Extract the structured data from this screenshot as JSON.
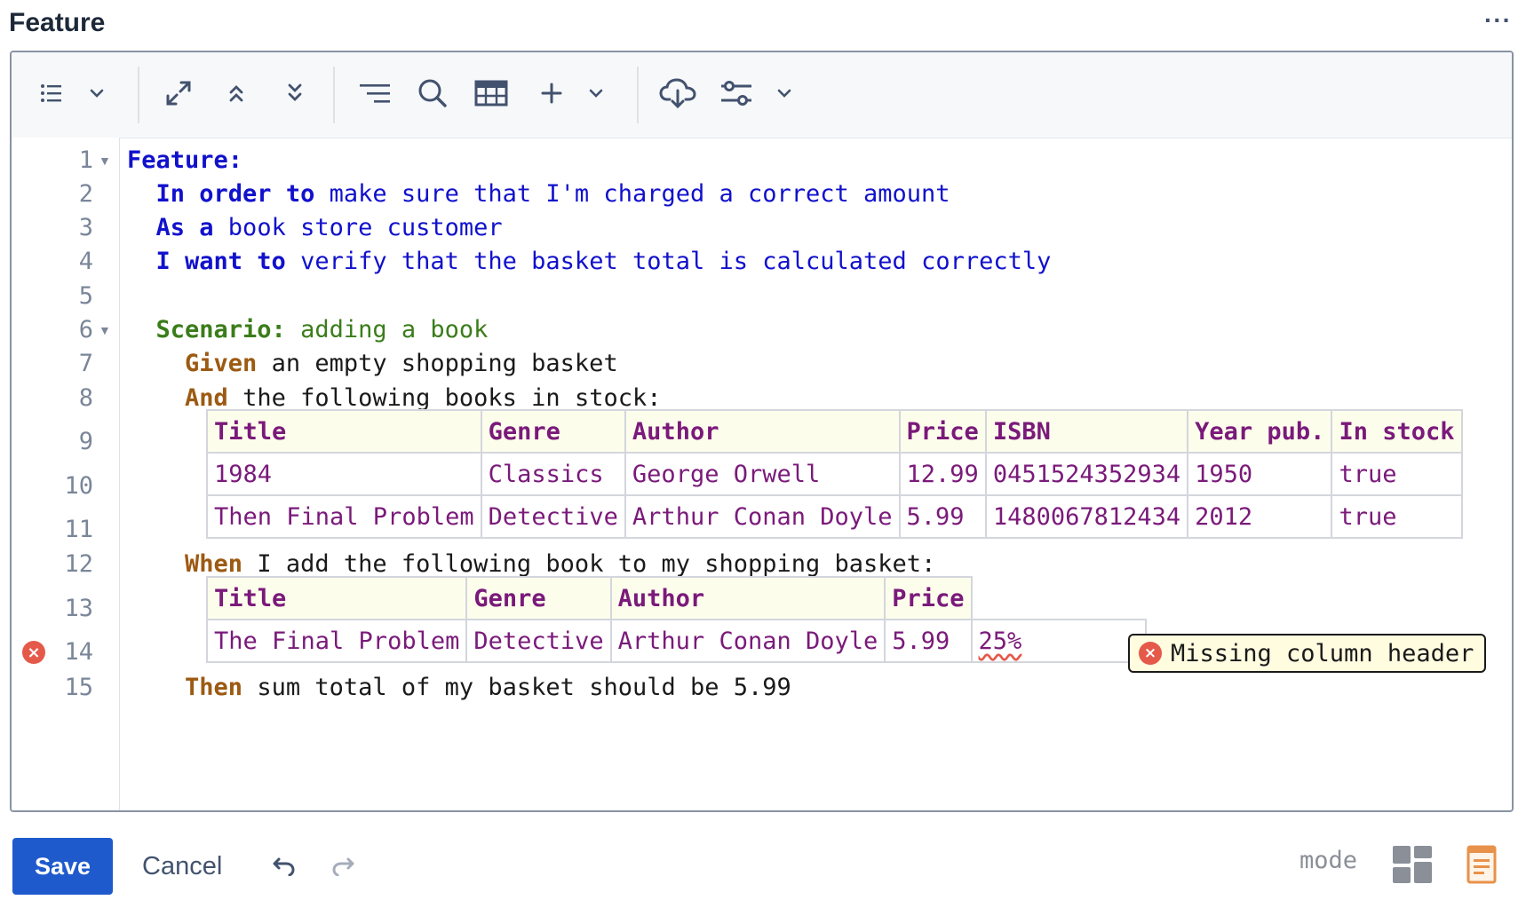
{
  "header": {
    "title": "Feature",
    "more_label": "···"
  },
  "toolbar": {
    "icons": [
      "list-icon",
      "chevron-down-icon",
      "expand-icon",
      "collapse-up-icon",
      "collapse-down-icon",
      "format-icon",
      "search-icon",
      "table-icon",
      "plus-icon",
      "chevron-down-icon",
      "cloud-download-icon",
      "settings-sliders-icon",
      "chevron-down-icon"
    ]
  },
  "editor": {
    "line_numbers": [
      "1",
      "2",
      "3",
      "4",
      "5",
      "6",
      "7",
      "8",
      "9",
      "10",
      "11",
      "12",
      "13",
      "14",
      "15"
    ],
    "line1": {
      "kw": "Feature:"
    },
    "line2": {
      "kw": "In order to",
      "text": " make sure that I'm charged a correct amount"
    },
    "line3": {
      "kw": "As a",
      "text": " book store customer"
    },
    "line4": {
      "kw": "I want to",
      "text": " verify that the basket total is calculated correctly"
    },
    "line6": {
      "kw": "Scenario:",
      "text": " adding a book"
    },
    "line7": {
      "kw": "Given",
      "text": " an empty shopping basket"
    },
    "line8": {
      "kw": "And",
      "text": " the following books in stock:"
    },
    "table1": {
      "headers": [
        "Title",
        "Genre",
        "Author",
        "Price",
        "ISBN",
        "Year pub.",
        "In stock"
      ],
      "rows": [
        [
          "1984",
          "Classics",
          "George Orwell",
          "12.99",
          "0451524352934",
          "1950",
          "true"
        ],
        [
          "Then Final Problem",
          "Detective",
          "Arthur Conan Doyle",
          "5.99",
          "1480067812434",
          "2012",
          "true"
        ]
      ]
    },
    "line12": {
      "kw": "When",
      "text": " I add the following book to my shopping basket:"
    },
    "table2": {
      "headers": [
        "Title",
        "Genre",
        "Author",
        "Price"
      ],
      "rows": [
        [
          "The Final Problem",
          "Detective",
          "Arthur Conan Doyle",
          "5.99",
          "25%"
        ]
      ]
    },
    "line15": {
      "kw": "Then",
      "text": " sum total of my basket should be 5.99"
    },
    "error": {
      "message": "Missing column header",
      "line": "14"
    }
  },
  "footer": {
    "save_label": "Save",
    "cancel_label": "Cancel",
    "mode_label": "mode",
    "accent_color": "#1f5acd",
    "error_color": "#e5594a"
  }
}
